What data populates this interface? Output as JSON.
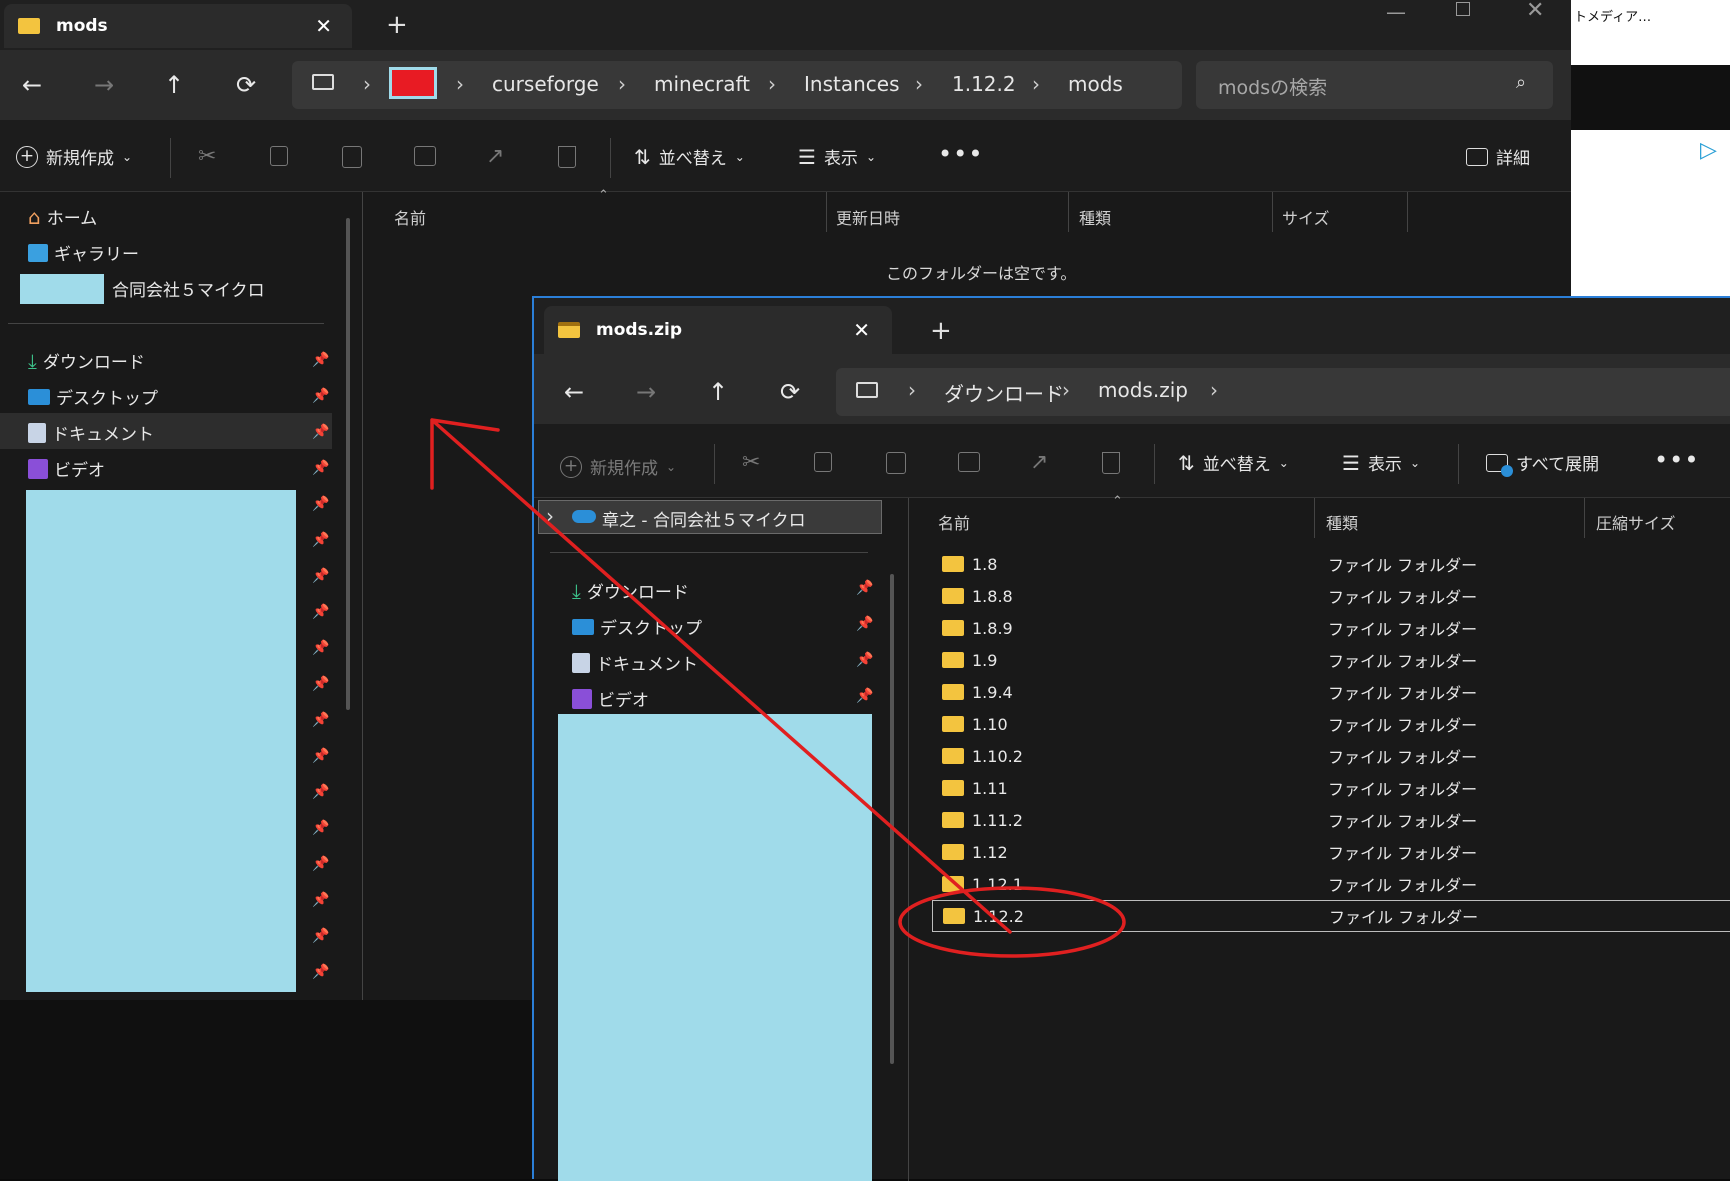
{
  "back_window": {
    "tab_title": "mods",
    "search_placeholder": "modsの検索",
    "breadcrumbs": [
      "curseforge",
      "minecraft",
      "Instances",
      "1.12.2",
      "mods"
    ],
    "toolbar": {
      "new": "新規作成",
      "sort": "並べ替え",
      "view": "表示",
      "details": "詳細"
    },
    "columns": [
      "名前",
      "更新日時",
      "種類",
      "サイズ"
    ],
    "empty_message": "このフォルダーは空です。",
    "quick": {
      "home": "ホーム",
      "gallery": "ギャラリー",
      "company": "合同会社５マイクロ"
    },
    "pinned": [
      "ダウンロード",
      "デスクトップ",
      "ドキュメント",
      "ビデオ"
    ]
  },
  "front_window": {
    "tab_title": "mods.zip",
    "breadcrumbs": [
      "ダウンロード",
      "mods.zip"
    ],
    "toolbar": {
      "new": "新規作成",
      "sort": "並べ替え",
      "view": "表示",
      "extract": "すべて展開"
    },
    "onedrive": "章之 - 合同会社５マイクロ",
    "pinned": [
      "ダウンロード",
      "デスクトップ",
      "ドキュメント",
      "ビデオ"
    ],
    "columns": [
      "名前",
      "種類",
      "圧縮サイズ"
    ],
    "files": [
      {
        "name": "1.8",
        "type": "ファイル フォルダー"
      },
      {
        "name": "1.8.8",
        "type": "ファイル フォルダー"
      },
      {
        "name": "1.8.9",
        "type": "ファイル フォルダー"
      },
      {
        "name": "1.9",
        "type": "ファイル フォルダー"
      },
      {
        "name": "1.9.4",
        "type": "ファイル フォルダー"
      },
      {
        "name": "1.10",
        "type": "ファイル フォルダー"
      },
      {
        "name": "1.10.2",
        "type": "ファイル フォルダー"
      },
      {
        "name": "1.11",
        "type": "ファイル フォルダー"
      },
      {
        "name": "1.11.2",
        "type": "ファイル フォルダー"
      },
      {
        "name": "1.12",
        "type": "ファイル フォルダー"
      },
      {
        "name": "1.12.1",
        "type": "ファイル フォルダー"
      },
      {
        "name": "1.12.2",
        "type": "ファイル フォルダー"
      }
    ]
  },
  "ad_text": "トメディア…",
  "colors": {
    "redaction": "#a0dbea",
    "annotation": "#e02020",
    "folder": "#f3c43f"
  }
}
